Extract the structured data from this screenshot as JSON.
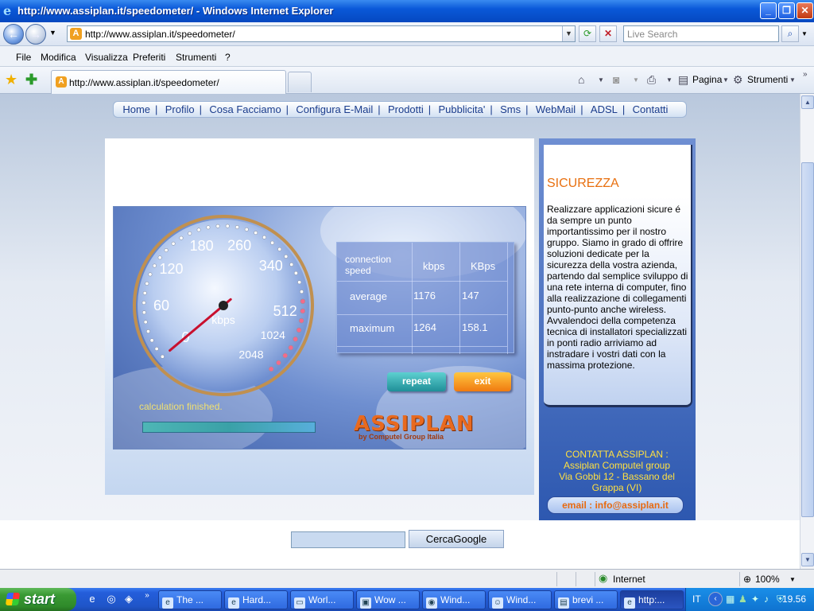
{
  "window": {
    "title": "http://www.assiplan.it/speedometer/ - Windows Internet Explorer",
    "url": "http://www.assiplan.it/speedometer/",
    "search_placeholder": "Live Search",
    "tab_title": "http://www.assiplan.it/speedometer/"
  },
  "menu": {
    "items": [
      "File",
      "Modifica",
      "Visualizza",
      "Preferiti",
      "Strumenti",
      "?"
    ]
  },
  "toolbar": {
    "pagina_label": "Pagina",
    "strumenti_label": "Strumenti"
  },
  "sitenav": {
    "links": [
      "Home",
      "Profilo",
      "Cosa Facciamo",
      "Configura E-Mail",
      "Prodotti",
      "Pubblicita'",
      "Sms",
      "WebMail",
      "ADSL",
      "Contatti"
    ]
  },
  "speedometer": {
    "gauge_labels": [
      {
        "text": "0",
        "value": 0
      },
      {
        "text": "60",
        "value": 60
      },
      {
        "text": "120",
        "value": 120
      },
      {
        "text": "180",
        "value": 180
      },
      {
        "text": "260",
        "value": 260
      },
      {
        "text": "340",
        "value": 340
      },
      {
        "text": "512",
        "value": 512
      },
      {
        "text": "1024",
        "value": 1024
      },
      {
        "text": "2048",
        "value": 2048
      }
    ],
    "unit": "kbps",
    "status": "calculation finished.",
    "progress": 1.0,
    "table": {
      "header": [
        "connection speed",
        "kbps",
        "KBps"
      ],
      "rows": [
        {
          "label": "average",
          "kbps": "1176",
          "KBps": "147"
        },
        {
          "label": "maximum",
          "kbps": "1264",
          "KBps": "158.1"
        }
      ]
    },
    "repeat_label": "repeat",
    "exit_label": "exit",
    "logo_text": "ASSIPLAN",
    "logo_sub": "by Computel Group Italia"
  },
  "sidebar": {
    "title": "SICUREZZA",
    "text": "Realizzare applicazioni sicure é da sempre un punto importantissimo per il nostro gruppo. Siamo in grado di offrire soluzioni dedicate per la sicurezza della vostra azienda, partendo dal semplice sviluppo di una rete interna di computer, fino alla realizzazione di collegamenti punto-punto anche wireless. Avvalendoci della competenza tecnica di installatori specializzati in ponti radio arriviamo ad instradare i vostri dati con la massima protezione.",
    "contact_lines": [
      "CONTATTA ASSIPLAN :",
      "Assiplan Computel group",
      "Via Gobbi 12 - Bassano del Grappa (VI)"
    ],
    "email": "email : info@assiplan.it"
  },
  "google": {
    "button_label": "CercaGoogle",
    "value": ""
  },
  "statusbar": {
    "zone": "Internet",
    "zoom": "100%"
  },
  "taskbar": {
    "start_label": "start",
    "tasks": [
      "The ...",
      "Hard...",
      "Worl...",
      "Wow ...",
      "Wind...",
      "Wind...",
      "brevi ...",
      "http:..."
    ],
    "language": "IT",
    "clock": "19.56"
  },
  "colors": {
    "accent_orange": "#e87010",
    "needle": "#c8102e",
    "xp_blue": "#245edb"
  }
}
